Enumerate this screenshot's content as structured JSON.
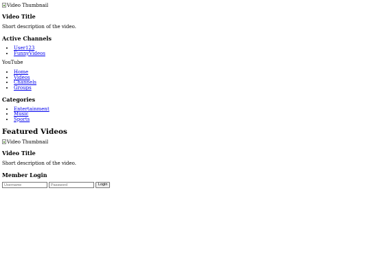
{
  "top_video": {
    "thumbnail_alt": "Video Thumbnail",
    "title": "Video Title",
    "description": "Short description of the video."
  },
  "active_channels": {
    "heading": "Active Channels",
    "items": [
      "User123",
      "FunnyVideos"
    ]
  },
  "brand": "YouTube",
  "nav": {
    "items": [
      "Home",
      "Videos",
      "Channels",
      "Groups"
    ]
  },
  "categories": {
    "heading": "Categories",
    "items": [
      "Entertainment",
      "Music",
      "Sports"
    ]
  },
  "featured": {
    "heading": "Featured Videos",
    "thumbnail_alt": "Video Thumbnail",
    "title": "Video Title",
    "description": "Short description of the video."
  },
  "login": {
    "heading": "Member Login",
    "username_placeholder": "Username",
    "password_placeholder": "Password",
    "button_label": "Login"
  },
  "colors": {
    "link": "#0000ee",
    "text": "#000000",
    "background": "#ffffff"
  },
  "icons": {
    "thumbnail": "broken-image-icon"
  }
}
